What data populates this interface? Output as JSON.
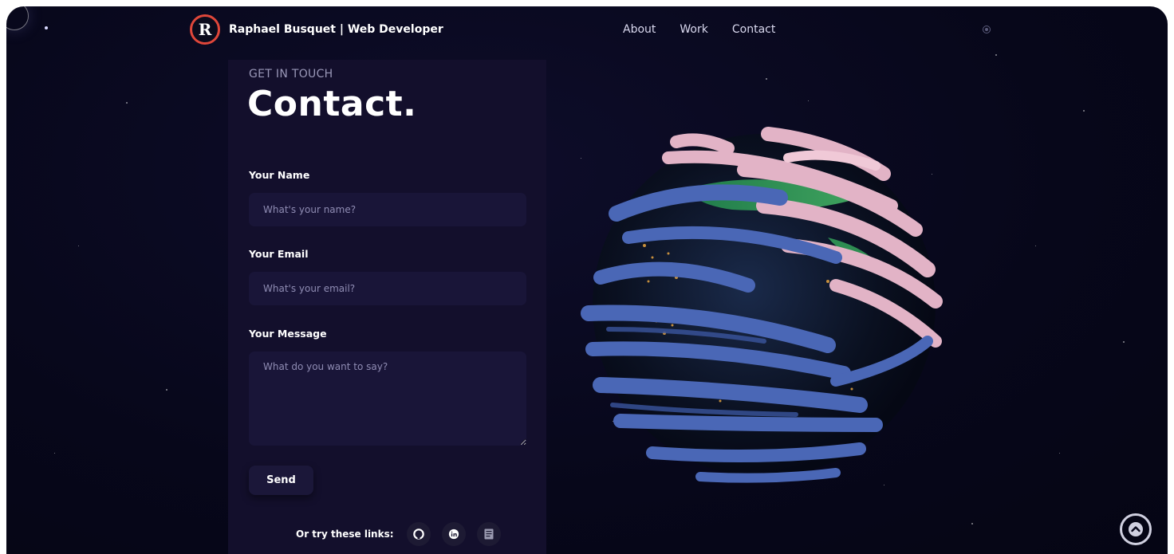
{
  "header": {
    "logo_letter": "R",
    "brand": "Raphael Busquet | Web Developer",
    "nav": [
      "About",
      "Work",
      "Contact"
    ]
  },
  "contact": {
    "eyebrow": "GET IN TOUCH",
    "title": "Contact.",
    "name_label": "Your Name",
    "name_placeholder": "What's your name?",
    "email_label": "Your Email",
    "email_placeholder": "What's your email?",
    "message_label": "Your Message",
    "message_placeholder": "What do you want to say?",
    "send_label": "Send",
    "links_label": "Or try these links:",
    "link_icons": [
      "github-icon",
      "linkedin-icon",
      "resume-icon"
    ]
  },
  "scene": {
    "object": "3D globe wrapped in pink and blue ribbons"
  },
  "colors": {
    "background": "#07071a",
    "panel": "#130f2c",
    "input": "#191538",
    "logo_ring": "#e0473a",
    "ribbon_pink": "#e2b3c6",
    "ribbon_blue": "#4a67b6"
  }
}
